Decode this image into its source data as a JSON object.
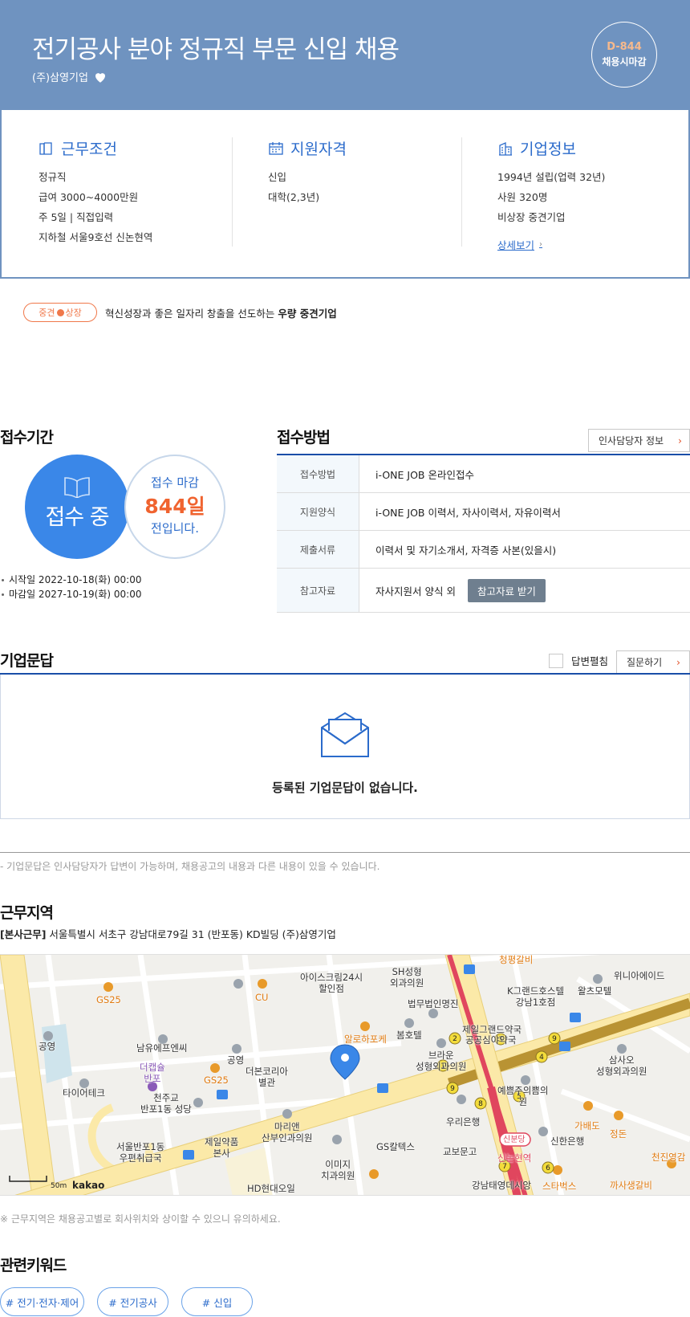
{
  "header": {
    "title": "전기공사 분야 정규직 부문 신입 채용",
    "company": "(주)삼영기업",
    "dday_count": "D-844",
    "dday_label": "채용시마감"
  },
  "conditions": {
    "title": "근무조건",
    "lines": [
      "정규직",
      "급여 3000~4000만원",
      "주 5일 | 직접입력",
      "지하철 서울9호선 신논현역"
    ]
  },
  "qualification": {
    "title": "지원자격",
    "lines": [
      "신입",
      "대학(2,3년)"
    ]
  },
  "company_info": {
    "title": "기업정보",
    "lines": [
      "1994년 설립(업력 32년)",
      "사원 320명",
      "비상장 중견기업"
    ],
    "detail_link": "상세보기"
  },
  "badge": {
    "left": "중견",
    "right": "상장",
    "desc_prefix": "혁신성장과 좋은 일자리 창출을 선도하는",
    "desc_bold": "우량 중견기업"
  },
  "period": {
    "title": "접수기간",
    "status": "접수 중",
    "deadline_label": "접수 마감",
    "deadline_days": "844일",
    "deadline_suffix": "전입니다.",
    "start": "시작일 2022-10-18(화) 00:00",
    "end": "마감일 2027-10-19(화) 00:00"
  },
  "method": {
    "title": "접수방법",
    "hr_button": "인사담당자 정보",
    "rows": [
      {
        "key": "접수방법",
        "value": "i-ONE JOB 온라인접수"
      },
      {
        "key": "지원양식",
        "value": "i-ONE JOB 이력서, 자사이력서, 자유이력서"
      },
      {
        "key": "제출서류",
        "value": "이력서 및 자기소개서, 자격증 사본(있을시)"
      },
      {
        "key": "참고자료",
        "value": "자사지원서 양식 외",
        "button": "참고자료 받기"
      }
    ]
  },
  "qa": {
    "title": "기업문답",
    "toggle_label": "답변펼침",
    "ask_button": "질문하기",
    "empty": "등록된 기업문답이 없습니다.",
    "note": "- 기업문답은 인사담당자가 답변이 가능하며, 채용공고의 내용과 다른 내용이 있을 수 있습니다."
  },
  "location": {
    "title": "근무지역",
    "office_type": "[본사근무]",
    "address": "서울특별시 서초구 강남대로79길 31 (반포동) KD빌딩 (주)삼영기업",
    "note": "※ 근무지역은 채용공고별로 회사위치와 상이할 수 있으니 유의하세요.",
    "map": {
      "scale": "50m",
      "brand": "kakao",
      "labels": {
        "gs25_1": "GS25",
        "park1": "공영",
        "cu": "CU",
        "icecream": "아이스크림24시\n할인점",
        "sh": "SH성형\n외과의원",
        "law": "법무법인명진",
        "kgrand": "K그랜드호스텔\n강남1호점",
        "whales": "왈츠모텔",
        "winia": "위니아에이드",
        "nam": "남유에프엔씨",
        "park2": "공영",
        "gs25_2": "GS25",
        "dcafe": "더캡슐\n반포",
        "theborn": "더본코리아\n별관",
        "tire": "타이어테크",
        "church": "천주교\n반포1동 성당",
        "food": "알로하포케",
        "bom": "봄호텔",
        "brown": "브라운\n성형외과의원",
        "jeil": "제일그랜드약국",
        "gonggong": "공공심야약국",
        "samsao": "삼사오\n성형외과의원",
        "yeppeum": "예쁨주의쁨의\n원",
        "woori": "우리은행",
        "gyobo": "교보문고",
        "shinhan": "신한은행",
        "gabaedo": "가배도",
        "jeongdon": "정돈",
        "marian": "마리앤\n산부인과의원",
        "jeilpharm": "제일약품\n본사",
        "banpo": "서울반포1동\n우편취급국",
        "gscaltex": "GS칼텍스",
        "imiji": "이미지\n치과의원",
        "hd": "HD현대오일",
        "sinnon": "신분당",
        "sinnonhyeon": "신논현역",
        "gangnam": "강남태영데시앙",
        "star": "스타벅스",
        "kkasaeng": "까사생갈비",
        "cheonjin": "천진영감",
        "chungpyeong": "청평갈비"
      }
    }
  },
  "keywords": {
    "title": "관련키워드",
    "items": [
      "# 전기·전자·제어",
      "# 전기공사",
      "# 신입"
    ]
  },
  "colors": {
    "header_bg": "#6f93c0",
    "accent_blue": "#2b6bcb",
    "accent_orange": "#f0632f"
  }
}
